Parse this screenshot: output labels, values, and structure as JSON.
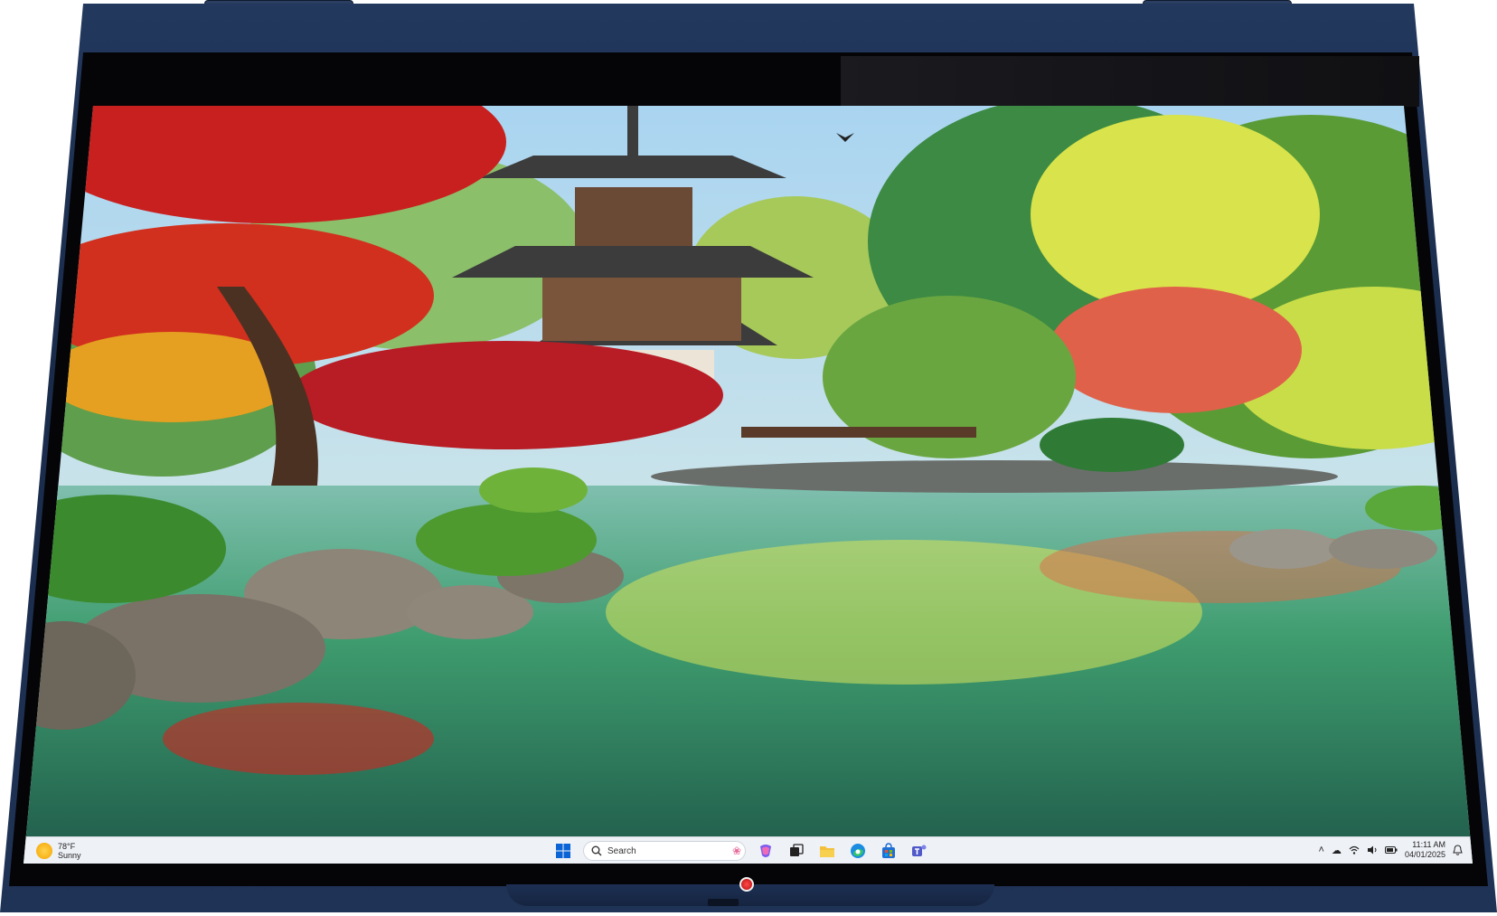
{
  "taskbar": {
    "weather": {
      "temperature": "78°F",
      "condition": "Sunny",
      "icon": "sun-icon"
    },
    "search": {
      "label": "Search"
    },
    "pinned_apps": [
      {
        "name": "copilot",
        "icon": "copilot-icon"
      },
      {
        "name": "task-view",
        "icon": "task-view-icon"
      },
      {
        "name": "file-explorer",
        "icon": "folder-icon"
      },
      {
        "name": "edge",
        "icon": "edge-icon"
      },
      {
        "name": "store",
        "icon": "store-icon"
      },
      {
        "name": "teams",
        "icon": "teams-icon"
      }
    ],
    "tray": {
      "time": "11:11 AM",
      "date": "04/01/2025"
    }
  },
  "colors": {
    "chassis": "#1f3356",
    "taskbar": "#eef1f6",
    "accent_blue": "#0a64d6",
    "camera_red": "#d11a1a"
  }
}
